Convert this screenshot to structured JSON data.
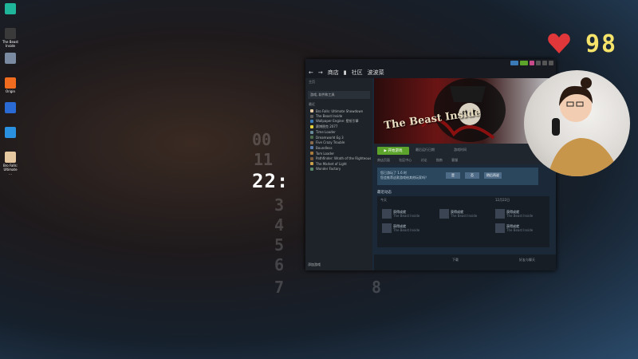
{
  "desktop": {
    "icons": [
      {
        "label": "",
        "color": "#1fb59a"
      },
      {
        "label": "The Beast Inside",
        "color": "#3a3a3a"
      },
      {
        "label": "",
        "color": "#7a8aa0"
      },
      {
        "label": "Origin",
        "color": "#f26c1f"
      },
      {
        "label": "",
        "color": "#2a6ad4"
      },
      {
        "label": "",
        "color": "#2a90e0"
      },
      {
        "label": "Bro Falls: Ultimate ...",
        "color": "#e6c8a0"
      }
    ]
  },
  "clock": {
    "time": "22:",
    "bg_digits": [
      "00",
      "11",
      "22",
      "3",
      "4",
      "5",
      "6",
      "7",
      "8"
    ]
  },
  "overlay": {
    "counter": "98",
    "heart_color": "#e0383a",
    "counter_color": "#f5e36a"
  },
  "steam": {
    "nav": {
      "store": "商店",
      "community": "社区",
      "username": "波波菜"
    },
    "sidebar": {
      "home": "主页",
      "filter": "游戏, 软件和工具",
      "section": "最近",
      "games": [
        {
          "name": "Bro Falls: Ultimate Showdown",
          "color": "#e6c8a0"
        },
        {
          "name": "The Beast Inside",
          "color": "#5a5a5a"
        },
        {
          "name": "Wallpaper Engine: 壁纸引擎",
          "color": "#3a7ab8"
        },
        {
          "name": "赛博朋克 2077",
          "color": "#e6d23a"
        },
        {
          "name": "Time Loader",
          "color": "#6a8a9a"
        },
        {
          "name": "Dreamworld Eg 3",
          "color": "#4a6a4a"
        },
        {
          "name": "Five Crazy Trouble",
          "color": "#8a6a4a"
        },
        {
          "name": "Boundless",
          "color": "#5a7aaa"
        },
        {
          "name": "Tom Loader",
          "color": "#aa7a3a"
        },
        {
          "name": "Pathfinder: Wrath of the Righteous",
          "color": "#7a5a3a"
        },
        {
          "name": "The Market of Light",
          "color": "#caa04a"
        },
        {
          "name": "Wonder Factory",
          "color": "#5a8a6a"
        }
      ],
      "add_game": "添加游戏"
    },
    "game": {
      "hero_title": "The Beast Inside",
      "play": "开始游戏",
      "last_played_label": "最后运行日期",
      "playtime_label": "游戏时间",
      "tabs": [
        "商店页面",
        "社区中心",
        "讨论",
        "指南",
        "客服"
      ],
      "review_line1": "您已游玩了 1.6 时",
      "review_line2": "您会推荐这款游戏给其他玩家吗？",
      "review_yes": "是",
      "review_no": "否",
      "review_later": "稍后再说",
      "activity_title": "最近动态",
      "activity_sub_left": "今天",
      "activity_sub_right": "12月22日",
      "cards": [
        {
          "t1": "获得成就",
          "t2": "The Beast Inside"
        },
        {
          "t1": "获得成就",
          "t2": "The Beast Inside"
        },
        {
          "t1": "获得成就",
          "t2": "The Beast Inside"
        },
        {
          "t1": "获得成就",
          "t2": "The Beast Inside"
        },
        {
          "t1": "获得成就",
          "t2": "The Beast Inside"
        }
      ],
      "downloads": "下载",
      "friends_chat": "好友与聊天"
    }
  }
}
